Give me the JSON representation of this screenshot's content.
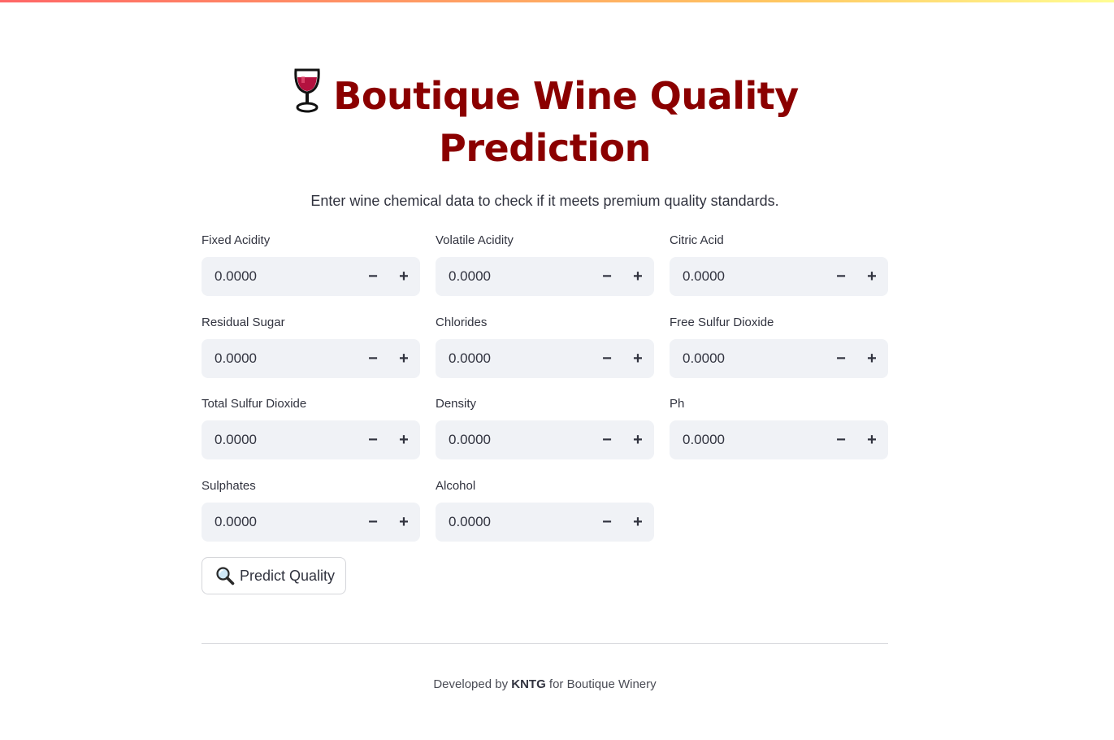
{
  "header": {
    "title_line1": "Boutique Wine Quality",
    "title_line2": "Prediction",
    "subtitle": "Enter wine chemical data to check if it meets premium quality standards."
  },
  "fields": [
    {
      "label": "Fixed Acidity",
      "value": "0.0000"
    },
    {
      "label": "Volatile Acidity",
      "value": "0.0000"
    },
    {
      "label": "Citric Acid",
      "value": "0.0000"
    },
    {
      "label": "Residual Sugar",
      "value": "0.0000"
    },
    {
      "label": "Chlorides",
      "value": "0.0000"
    },
    {
      "label": "Free Sulfur Dioxide",
      "value": "0.0000"
    },
    {
      "label": "Total Sulfur Dioxide",
      "value": "0.0000"
    },
    {
      "label": "Density",
      "value": "0.0000"
    },
    {
      "label": "Ph",
      "value": "0.0000"
    },
    {
      "label": "Sulphates",
      "value": "0.0000"
    },
    {
      "label": "Alcohol",
      "value": "0.0000"
    }
  ],
  "stepper": {
    "minus": "−",
    "plus": "+"
  },
  "predict_button": {
    "label": "Predict Quality",
    "icon": "magnifying-glass-icon"
  },
  "footer": {
    "prefix": "Developed by ",
    "author": "KNTG",
    "suffix": " for Boutique Winery"
  },
  "colors": {
    "title": "#8b0000",
    "input_bg": "#f0f2f6",
    "top_bar_start": "#ff4b4b",
    "top_bar_end": "#fffd80"
  }
}
